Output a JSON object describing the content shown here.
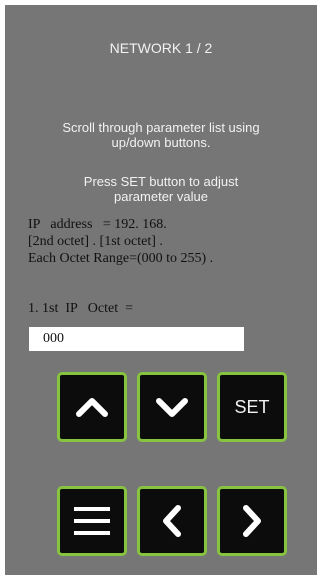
{
  "header": {
    "title": "NETWORK 1 / 2"
  },
  "instructions": {
    "scroll_line1": "Scroll through parameter list using",
    "scroll_line2": "up/down buttons.",
    "set_line1": "Press SET button to adjust",
    "set_line2": "parameter value"
  },
  "ip_info": {
    "line1": "IP   address   = 192. 168.",
    "line2": "[2nd octet] . [1st octet] .",
    "line3": "Each Octet Range=(000 to 255) ."
  },
  "parameter": {
    "label": "1. 1st  IP   Octet  =",
    "value": "000"
  },
  "buttons": {
    "up_icon": "chevron-up-icon",
    "down_icon": "chevron-down-icon",
    "set_label": "SET",
    "menu_icon": "menu-icon",
    "left_icon": "chevron-left-icon",
    "right_icon": "chevron-right-icon"
  },
  "colors": {
    "panel": "#767676",
    "button_bg": "#0c0c0c",
    "button_border": "#86c440"
  }
}
